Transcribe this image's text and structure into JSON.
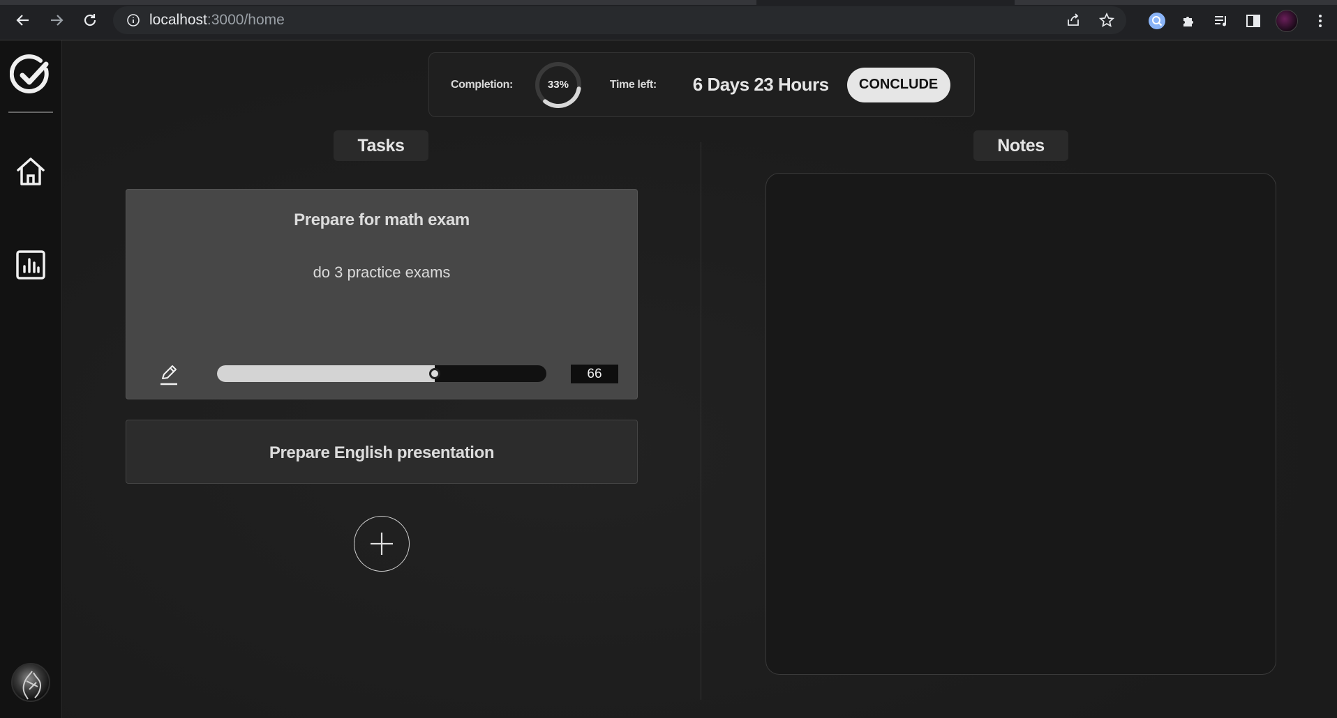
{
  "browser": {
    "url_host": "localhost",
    "url_path": ":3000/home"
  },
  "status": {
    "completion_label": "Completion:",
    "completion_percent": "33%",
    "completion_value": 33,
    "time_left_label": "Time left:",
    "time_left_value": "6 Days 23 Hours",
    "conclude_label": "CONCLUDE"
  },
  "sections": {
    "tasks_title": "Tasks",
    "notes_title": "Notes"
  },
  "tasks": [
    {
      "title": "Prepare for math exam",
      "description": "do 3 practice exams",
      "progress": 66,
      "progress_label": "66"
    },
    {
      "title": "Prepare English presentation"
    }
  ],
  "icons": {
    "logo": "check-circle-icon",
    "home": "home-icon",
    "stats": "bar-chart-icon",
    "edit": "pencil-icon",
    "add": "plus-icon"
  },
  "colors": {
    "background": "#1b1b1b",
    "sidebar": "#121212",
    "card_expanded": "#474747",
    "card_collapsed": "#2c2c2c",
    "accent_button": "#e6e6e6"
  }
}
